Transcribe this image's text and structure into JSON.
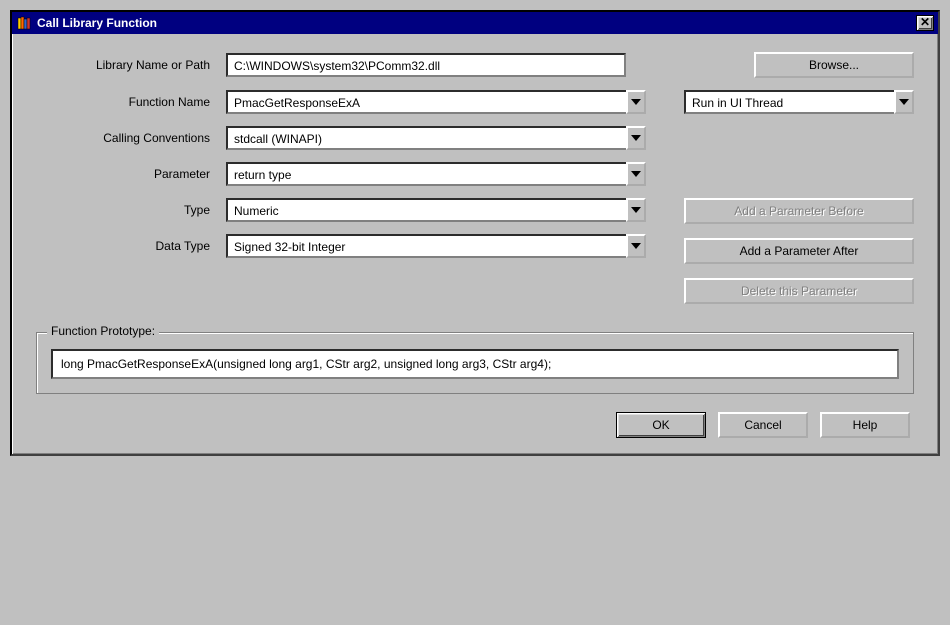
{
  "window": {
    "title": "Call Library Function",
    "icon": "books-icon"
  },
  "fields": {
    "libpath": {
      "label": "Library Name or Path",
      "value": "C:\\WINDOWS\\system32\\PComm32.dll"
    },
    "funcname": {
      "label": "Function Name",
      "value": "PmacGetResponseExA"
    },
    "callconv": {
      "label": "Calling Conventions",
      "value": "stdcall (WINAPI)"
    },
    "parameter": {
      "label": "Parameter",
      "value": "return type"
    },
    "type": {
      "label": "Type",
      "value": "Numeric"
    },
    "datatype": {
      "label": "Data Type",
      "value": "Signed 32-bit Integer"
    }
  },
  "thread": {
    "value": "Run in UI Thread"
  },
  "buttons": {
    "browse": "Browse...",
    "add_before": "Add a Parameter Before",
    "add_after": "Add a Parameter After",
    "delete": "Delete this Parameter",
    "ok": "OK",
    "cancel": "Cancel",
    "help": "Help"
  },
  "prototype": {
    "legend": "Function Prototype:",
    "text": "long PmacGetResponseExA(unsigned long arg1, CStr arg2, unsigned long arg3, CStr arg4);"
  }
}
